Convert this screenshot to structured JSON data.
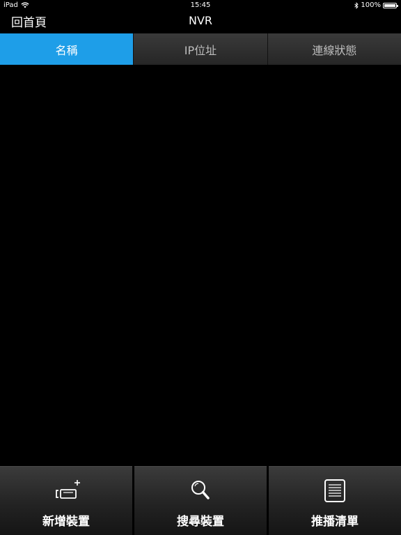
{
  "status": {
    "device": "iPad",
    "time": "15:45",
    "battery": "100%",
    "battery_level": 1.0
  },
  "nav": {
    "back_label": "回首頁",
    "title": "NVR"
  },
  "tabs": [
    {
      "label": "名稱",
      "active": true
    },
    {
      "label": "IP位址",
      "active": false
    },
    {
      "label": "連線狀態",
      "active": false
    }
  ],
  "toolbar": {
    "add_label": "新增裝置",
    "search_label": "搜尋裝置",
    "playlist_label": "推播清單"
  },
  "icons": {
    "wifi": "wifi-icon",
    "bluetooth": "bluetooth-icon",
    "battery": "battery-icon",
    "add_camera": "add-camera-icon",
    "search": "magnifier-icon",
    "list": "list-icon"
  },
  "colors": {
    "accent": "#1e9ee8",
    "background": "#000000"
  }
}
